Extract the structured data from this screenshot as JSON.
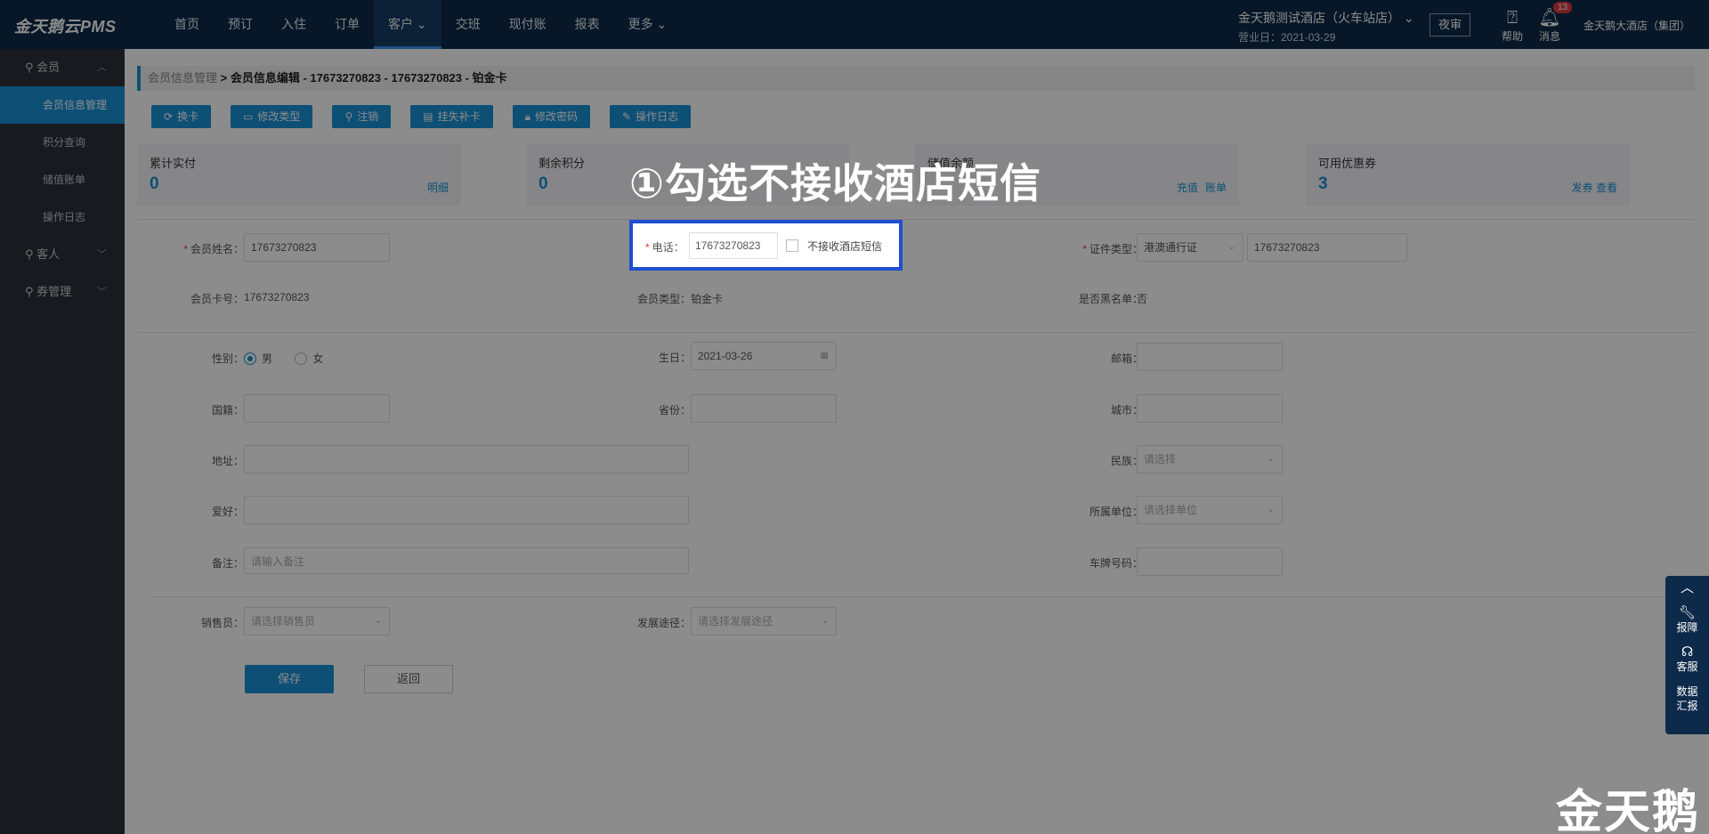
{
  "app": {
    "logo": "金天鹅云PMS"
  },
  "nav": [
    "首页",
    "预订",
    "入住",
    "订单",
    "客户 ⌄",
    "交班",
    "现付账",
    "报表",
    "更多 ⌄"
  ],
  "hotel": {
    "name": "金天鹅测试酒店（火车站店）  ⌄",
    "biz_date": "营业日：2021-03-29"
  },
  "night_audit": "夜审",
  "help": "帮助",
  "messages": {
    "label": "消息",
    "count": "13"
  },
  "group": "金天鹅大酒店（集团）",
  "sidebar": {
    "member": "会员",
    "items": [
      "会员信息管理",
      "积分查询",
      "储值账单",
      "操作日志"
    ],
    "guest": "客人",
    "coupon": "券管理"
  },
  "breadcrumb": {
    "parent": "会员信息管理",
    "sep": " > ",
    "current": "会员信息编辑 - 17673270823 - 17673270823 - 铂金卡"
  },
  "toolbar": [
    "换卡",
    "修改类型",
    "注销",
    "挂失补卡",
    "修改密码",
    "操作日志"
  ],
  "stats": [
    {
      "label": "累计实付",
      "value": "0",
      "links": [
        "明细"
      ]
    },
    {
      "label": "剩余积分",
      "value": "0",
      "links": []
    },
    {
      "label": "储值余额",
      "value": "",
      "links": [
        "充值",
        "账单"
      ]
    },
    {
      "label": "可用优惠券",
      "value": "3",
      "links": [
        "发券 查看"
      ]
    }
  ],
  "form": {
    "name_label": "会员姓名：",
    "name_value": "17673270823",
    "phone_label": "电话：",
    "phone_value": "17673270823",
    "no_sms_label": "不接收酒店短信",
    "idtype_label": "证件类型：",
    "idtype_value": "港澳通行证",
    "id_value": "17673270823",
    "card_label": "会员卡号：",
    "card_value": "17673270823",
    "type_label": "会员类型：",
    "type_value": "铂金卡",
    "blacklist_label": "是否黑名单：",
    "blacklist_value": "否",
    "gender_label": "性别：",
    "male": "男",
    "female": "女",
    "birthday_label": "生日：",
    "birthday_value": "2021-03-26",
    "email_label": "邮箱：",
    "nation_label": "国籍：",
    "province_label": "省份：",
    "city_label": "城市：",
    "address_label": "地址：",
    "ethnic_label": "民族：",
    "ethnic_ph": "请选择",
    "hobby_label": "爱好：",
    "unit_label": "所属单位：",
    "unit_ph": "请选择单位",
    "remark_label": "备注：",
    "remark_ph": "请输入备注",
    "plate_label": "车牌号码：",
    "sales_label": "销售员：",
    "sales_ph": "请选择销售员",
    "channel_label": "发展途径：",
    "channel_ph": "请选择发展途径",
    "save": "保存",
    "back": "返回"
  },
  "annotation": "①勾选不接收酒店短信",
  "float_panel": {
    "report": "报障",
    "service": "客服",
    "data": "数据\n汇报"
  },
  "watermark": "金天鹅"
}
